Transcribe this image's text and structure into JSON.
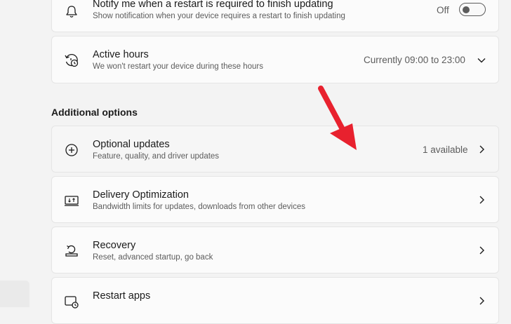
{
  "notify": {
    "title": "Notify me when a restart is required to finish updating",
    "subtitle": "Show notification when your device requires a restart to finish updating",
    "toggle_state": "Off",
    "icon": "bell-icon"
  },
  "active_hours": {
    "title": "Active hours",
    "subtitle": "We won't restart your device during these hours",
    "value": "Currently 09:00 to 23:00",
    "icon": "clock-restart-icon"
  },
  "section": {
    "title": "Additional options"
  },
  "optional_updates": {
    "title": "Optional updates",
    "subtitle": "Feature, quality, and driver updates",
    "value": "1 available",
    "icon": "plus-circle-icon"
  },
  "delivery_optimization": {
    "title": "Delivery Optimization",
    "subtitle": "Bandwidth limits for updates, downloads from other devices",
    "icon": "delivery-icon"
  },
  "recovery": {
    "title": "Recovery",
    "subtitle": "Reset, advanced startup, go back",
    "icon": "recovery-icon"
  },
  "restart_apps": {
    "title": "Restart apps",
    "icon": "restart-apps-icon"
  },
  "colors": {
    "background": "#f3f3f3",
    "card": "#fbfbfb",
    "annotation_arrow": "#e8212e"
  }
}
